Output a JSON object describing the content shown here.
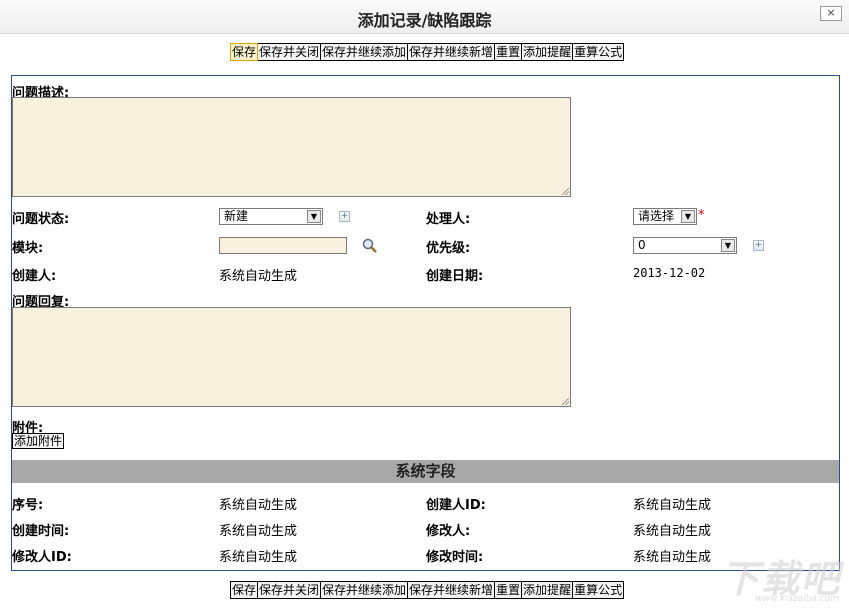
{
  "window": {
    "title": "添加记录/缺陷跟踪",
    "close_label": "×"
  },
  "toolbar": {
    "buttons": [
      "保存",
      "保存并关闭",
      "保存并继续添加",
      "保存并继续新增",
      "重置",
      "添加提醒",
      "重算公式"
    ]
  },
  "form": {
    "desc_label": "问题描述:",
    "status_label": "问题状态:",
    "status_value": "新建",
    "handler_label": "处理人:",
    "handler_value": "请选择",
    "required_mark": "*",
    "module_label": "模块:",
    "priority_label": "优先级:",
    "priority_value": "0",
    "creator_label": "创建人:",
    "creator_value": "系统自动生成",
    "created_date_label": "创建日期:",
    "created_date_value": "2013-12-02",
    "reply_label": "问题回复:",
    "attachment_label": "附件:",
    "add_attachment_label": "添加附件"
  },
  "system_fields": {
    "title": "系统字段",
    "seq_label": "序号:",
    "seq_value": "系统自动生成",
    "creator_id_label": "创建人ID:",
    "creator_id_value": "系统自动生成",
    "created_time_label": "创建时间:",
    "created_time_value": "系统自动生成",
    "modifier_label": "修改人:",
    "modifier_value": "系统自动生成",
    "modifier_id_label": "修改人ID:",
    "modifier_id_value": "系统自动生成",
    "modified_time_label": "修改时间:",
    "modified_time_value": "系统自动生成"
  },
  "watermark": {
    "text": "下载吧",
    "url": "www.xiazaiba.com"
  },
  "colors": {
    "field_bg": "#f9f1de",
    "panel_border": "#2b4e8c",
    "section_bar": "#a9a9a9",
    "required": "#dd0000"
  }
}
